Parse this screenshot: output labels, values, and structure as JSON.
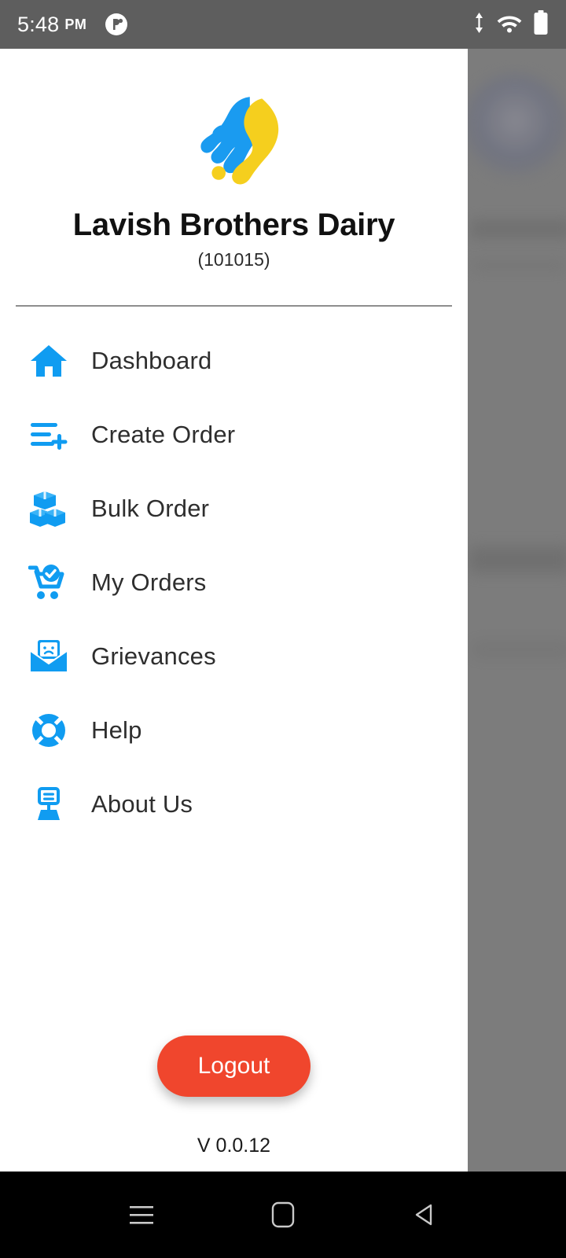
{
  "status_bar": {
    "time": "5:48",
    "ampm": "PM",
    "notification_icon": "app-notification-icon",
    "data_icon": "data-transfer-icon",
    "wifi_icon": "wifi-icon",
    "battery_icon": "battery-icon"
  },
  "drawer": {
    "logo_icon": "brand-logo-icon",
    "brand_title": "Lavish Brothers Dairy",
    "brand_code": "(101015)",
    "menu": [
      {
        "label": "Dashboard",
        "icon": "home-icon"
      },
      {
        "label": "Create Order",
        "icon": "create-order-icon"
      },
      {
        "label": "Bulk Order",
        "icon": "boxes-icon"
      },
      {
        "label": "My Orders",
        "icon": "cart-check-icon"
      },
      {
        "label": "Grievances",
        "icon": "envelope-sad-icon"
      },
      {
        "label": "Help",
        "icon": "lifebuoy-icon"
      },
      {
        "label": "About Us",
        "icon": "info-sign-icon"
      }
    ],
    "logout_label": "Logout",
    "version": "V 0.0.12"
  },
  "nav_bar": {
    "recents_icon": "recents-icon",
    "home_icon": "home-square-icon",
    "back_icon": "back-triangle-icon"
  },
  "colors": {
    "accent_blue": "#109cf1",
    "logo_yellow": "#f5cf1e",
    "logout_red": "#f0462d",
    "status_bar": "#5e5e5e",
    "scrim": "#7c7c7c"
  }
}
